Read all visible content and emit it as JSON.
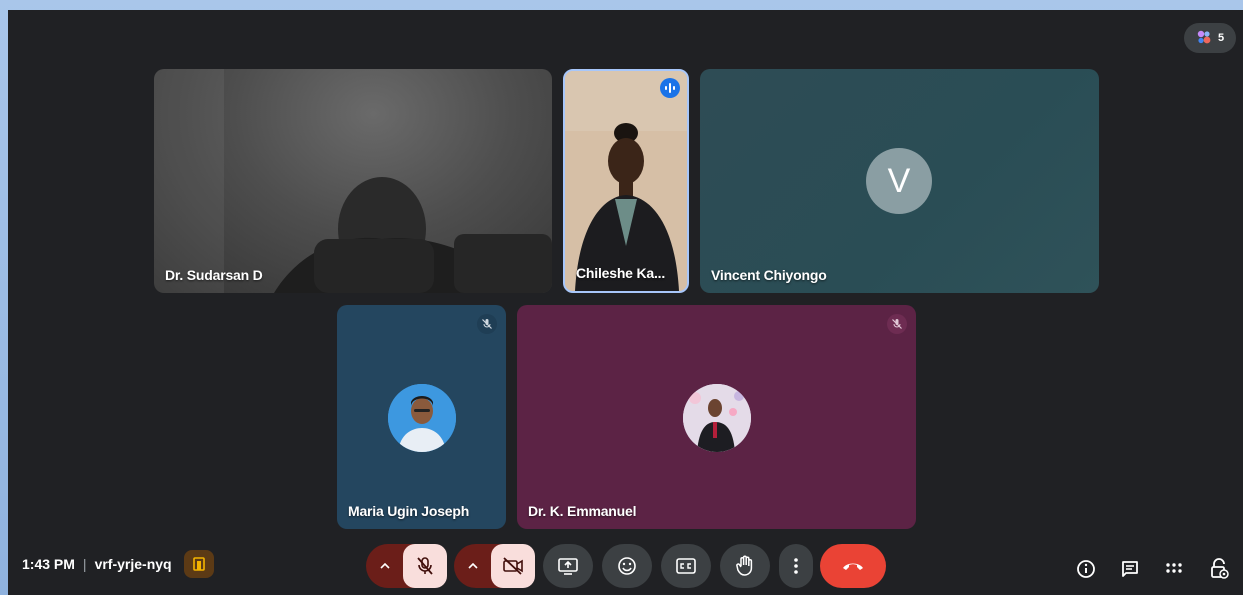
{
  "participants_count": "5",
  "tiles": {
    "sudarsan": {
      "name": "Dr. Sudarsan D"
    },
    "chileshe": {
      "name": "Chileshe Ka..."
    },
    "vincent": {
      "name": "Vincent Chiyongo",
      "initial": "V"
    },
    "maria": {
      "name": "Maria Ugin Joseph"
    },
    "emmanuel": {
      "name": "Dr. K. Emmanuel"
    }
  },
  "meeting": {
    "time": "1:43 PM",
    "separator": "|",
    "code": "vrf-yrje-nyq"
  },
  "colors": {
    "end_call": "#ea4335",
    "mic_off_bg": "#f9dedc",
    "accent": "#8ab4f8"
  }
}
